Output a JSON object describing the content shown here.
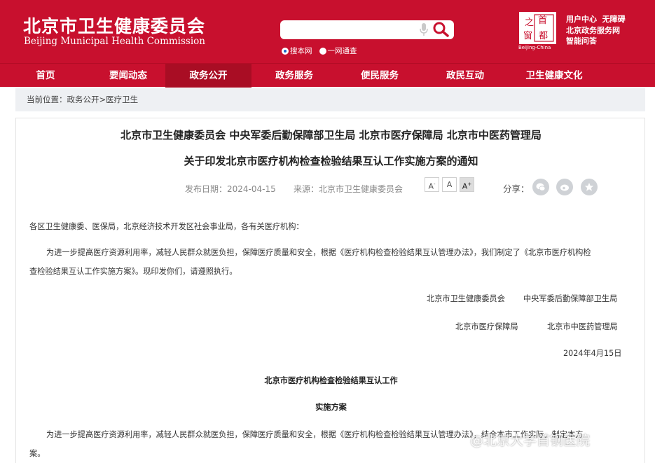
{
  "header": {
    "logo_cn": "北京市卫生健康委员会",
    "logo_en": "Beijing Municipal Health Commission",
    "search_placeholder": "",
    "radio_site": "搜本网",
    "radio_all": "一网通查",
    "emblem_caption": "Beijing-China",
    "links": [
      "用户中心",
      "无障碍",
      "北京政务服务网",
      "智能问答"
    ],
    "brand_color": "#c8102e"
  },
  "nav": {
    "items": [
      "首页",
      "要闻动态",
      "政务公开",
      "政务服务",
      "便民服务",
      "政民互动",
      "卫生健康文化"
    ],
    "active_index": 2
  },
  "breadcrumb": {
    "prefix": "当前位置：",
    "level1": "政务公开",
    "sep": ">",
    "level2": "医疗卫生"
  },
  "article": {
    "agencies": "北京市卫生健康委员会 中央军委后勤保障部卫生局 北京市医疗保障局 北京市中医药管理局",
    "title": "关于印发北京市医疗机构检查检验结果互认工作实施方案的通知",
    "date_label": "发布日期：",
    "date": "2024-04-15",
    "source_label": "来源：",
    "source": "北京市卫生健康委员会",
    "font_small": "A",
    "font_normal": "A",
    "font_large": "A",
    "share_label": "分享：",
    "salutation": "各区卫生健康委、医保局，北京经济技术开发区社会事业局，各有关医疗机构：",
    "para1_line1": "为进一步提高医疗资源利用率，减轻人民群众就医负担，保障医疗质量和安全，根据《医疗机构检查检验结果互认管理办法》，我们制定了《北京市医疗机构检",
    "para1_line2": "查检验结果互认工作实施方案》。现印发你们，请遵照执行。",
    "sign1": "北京市卫生健康委员会",
    "sign2": "中央军委后勤保障部卫生局",
    "sign3": "北京市医疗保障局",
    "sign4": "北京市中医药管理局",
    "sign_date": "2024年4月15日",
    "plan_title1": "北京市医疗机构检查检验结果互认工作",
    "plan_title2": "实施方案",
    "para2_line1": "为进一步提高医疗资源利用率，减轻人民群众就医负担，保障医疗质量和安全，根据《医疗机构检查检验结果互认管理办法》，结合本市工作实际，制定本方",
    "para2_line2": "案。"
  },
  "watermark": "@北京大学首钢医院"
}
